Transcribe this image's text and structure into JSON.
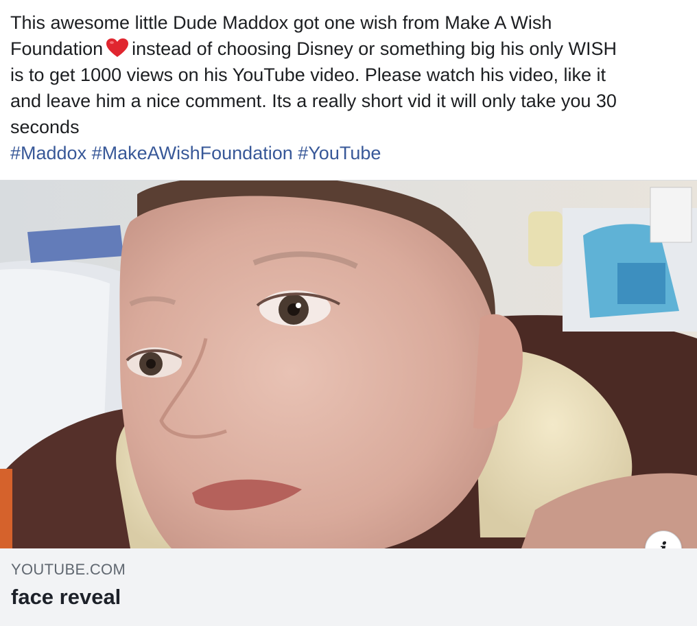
{
  "post": {
    "text_lines": [
      "This awesome little Dude Maddox got one wish from Make A Wish",
      "instead of choosing Disney or something big his only WISH",
      "is to get 1000 views on his YouTube video. Please watch his video, like it",
      "and leave him a nice comment. Its a really short vid it will only take you 30",
      "seconds"
    ],
    "line2_prefix": "Foundation",
    "heart_icon": "red-heart-emoji",
    "hashtags": [
      "#Maddox",
      "#MakeAWishFoundation",
      "#YouTube"
    ]
  },
  "link_card": {
    "domain": "YOUTUBE.COM",
    "title": "face reveal",
    "info_glyph": "i"
  },
  "colors": {
    "text": "#1c1e21",
    "hashtag": "#385898",
    "caption_bg": "#f2f3f5",
    "domain": "#606770",
    "heart": "#e0262f"
  }
}
